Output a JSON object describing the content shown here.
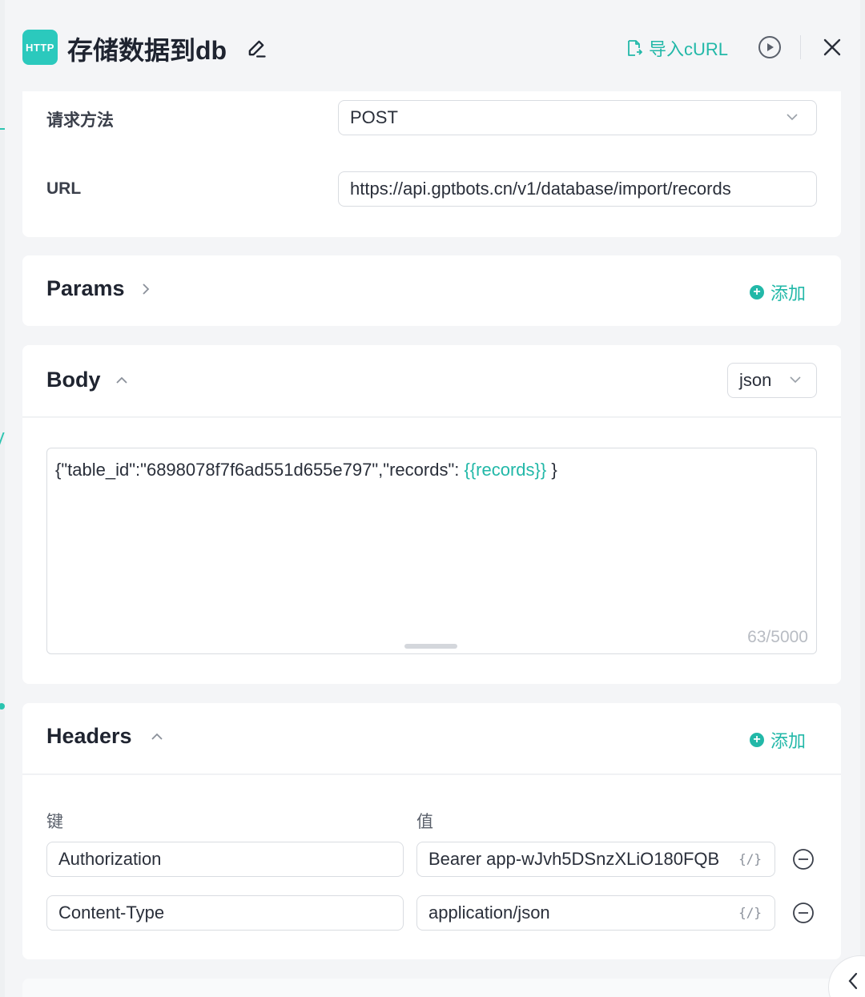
{
  "header": {
    "badge": "HTTP",
    "title": "存储数据到db",
    "import_label": "导入cURL"
  },
  "request": {
    "method_label": "请求方法",
    "method_value": "POST",
    "url_label": "URL",
    "url_value": "https://api.gptbots.cn/v1/database/import/records"
  },
  "params": {
    "title": "Params",
    "add_label": "添加"
  },
  "body": {
    "title": "Body",
    "format": "json",
    "code_prefix": "{\"table_id\":\"6898078f7f6ad551d655e797\",\"records\": ",
    "code_variable": "{{records}}",
    "code_suffix": " }",
    "counter": "63/5000"
  },
  "headers": {
    "title": "Headers",
    "add_label": "添加",
    "key_label": "键",
    "value_label": "值",
    "rows": [
      {
        "key": "Authorization",
        "value": "Bearer app-wJvh5DSnzXLiO180FQB",
        "tag": "{/}"
      },
      {
        "key": "Content-Type",
        "value": "application/json",
        "tag": "{/}"
      }
    ]
  },
  "colors": {
    "accent": "#22b8a8",
    "badge": "#2bc9bd"
  }
}
